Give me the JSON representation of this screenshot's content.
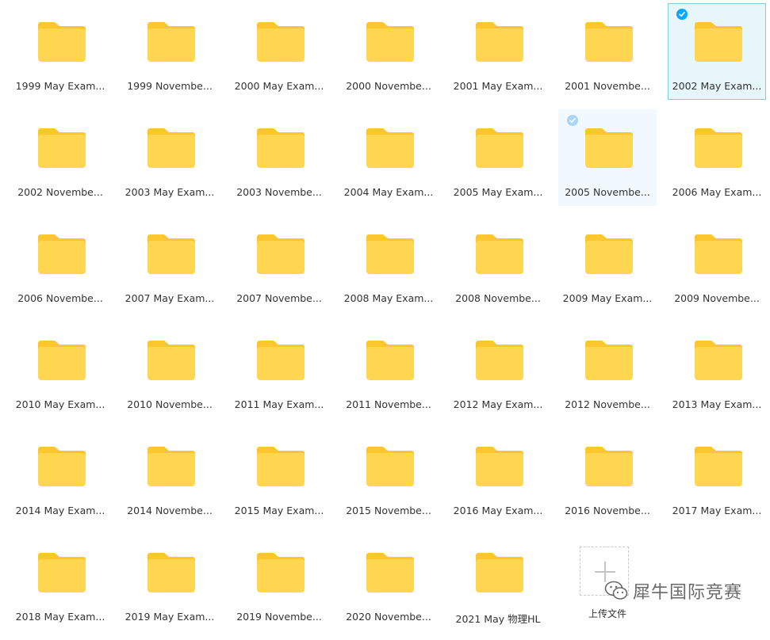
{
  "colors": {
    "folder_front": "#FFD64F",
    "folder_back": "#FCC72E",
    "selection_bg": "#E6F6FA",
    "selection_border": "#7FD0DF",
    "check_blue": "#06A7FF"
  },
  "folders": [
    {
      "name": "1999 May Exam..."
    },
    {
      "name": "1999 Novembe..."
    },
    {
      "name": "2000 May Exam..."
    },
    {
      "name": "2000 Novembe..."
    },
    {
      "name": "2001 May Exam..."
    },
    {
      "name": "2001 Novembe..."
    },
    {
      "name": "2002 May Exam...",
      "state": "selected"
    },
    {
      "name": "2002 Novembe..."
    },
    {
      "name": "2003 May Exam..."
    },
    {
      "name": "2003 Novembe..."
    },
    {
      "name": "2004 May Exam..."
    },
    {
      "name": "2005 May Exam..."
    },
    {
      "name": "2005 Novembe...",
      "state": "hovered"
    },
    {
      "name": "2006 May Exam..."
    },
    {
      "name": "2006 Novembe..."
    },
    {
      "name": "2007 May Exam..."
    },
    {
      "name": "2007 Novembe..."
    },
    {
      "name": "2008 May Exam..."
    },
    {
      "name": "2008 Novembe..."
    },
    {
      "name": "2009 May Exam..."
    },
    {
      "name": "2009 Novembe..."
    },
    {
      "name": "2010 May Exam..."
    },
    {
      "name": "2010 Novembe..."
    },
    {
      "name": "2011 May Exam..."
    },
    {
      "name": "2011 Novembe..."
    },
    {
      "name": "2012 May Exam..."
    },
    {
      "name": "2012 Novembe..."
    },
    {
      "name": "2013 May Exam..."
    },
    {
      "name": "2014 May Exam..."
    },
    {
      "name": "2014 Novembe..."
    },
    {
      "name": "2015 May Exam..."
    },
    {
      "name": "2015 Novembe..."
    },
    {
      "name": "2016 May Exam..."
    },
    {
      "name": "2016 Novembe..."
    },
    {
      "name": "2017 May Exam..."
    },
    {
      "name": "2018 May Exam..."
    },
    {
      "name": "2019 May Exam..."
    },
    {
      "name": "2019 Novembe..."
    },
    {
      "name": "2020 Novembe..."
    },
    {
      "name": "2021 May 物理HL"
    }
  ],
  "upload": {
    "label": "上传文件",
    "icon": "plus-icon"
  },
  "watermark": {
    "text": "犀牛国际竞赛",
    "icon": "wechat-icon"
  }
}
